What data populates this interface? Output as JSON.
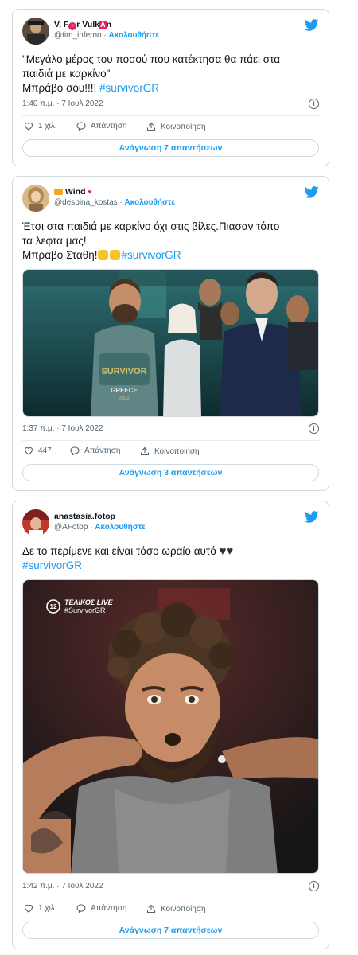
{
  "tweets": [
    {
      "name_parts": [
        "V. F",
        "○",
        "r Vulk",
        "A",
        "n"
      ],
      "handle": "@tim_inferno",
      "follow": "Ακολουθήστε",
      "text_line1": "\"Μεγάλο μέρος του ποσού που κατέκτησα θα πάει στα",
      "text_line2": "παιδιά με καρκίνο\"",
      "text_line3": "Μπράβο σου!!!! ",
      "hashtag": "#survivorGR",
      "timestamp": "1:40 π.μ. · 7 Ιουλ 2022",
      "likes": "1 χιλ.",
      "reply_label": "Απάντηση",
      "share_label": "Κοινοποίηση",
      "replies_button": "Ανάγνωση 7 απαντήσεων"
    },
    {
      "name": "Wind",
      "handle": "@despina_kostas",
      "follow": "Ακολουθήστε",
      "text_line1": "Έτσι στα παιδιά με καρκίνο όχι στις βίλες.Πιασαν τόπο",
      "text_line2": "τα λεφτα μας!",
      "text_line3": "Μπραβο Σταθη!",
      "hashtag": "#survivorGR",
      "image_text_1": "SURVIVOR",
      "image_text_2": "GREECE",
      "image_text_3": "2022",
      "timestamp": "1:37 π.μ. · 7 Ιουλ 2022",
      "likes": "447",
      "reply_label": "Απάντηση",
      "share_label": "Κοινοποίηση",
      "replies_button": "Ανάγνωση 3 απαντήσεων"
    },
    {
      "name": "anastasia.fotop",
      "handle": "@AFotop",
      "follow": "Ακολουθήστε",
      "text_line1": "Δε το περίμενε και είναι τόσο ωραίο αυτό ",
      "hashtag": "#survivorGR",
      "overlay_channel": "12",
      "overlay_title": "ΤΕΛΙΚΟΣ LIVE",
      "overlay_tag": "#SurvivorGR",
      "timestamp": "1:42 π.μ. · 7 Ιουλ 2022",
      "likes": "1 χιλ.",
      "reply_label": "Απάντηση",
      "share_label": "Κοινοποίηση",
      "replies_button": "Ανάγνωση 7 απαντήσεων"
    }
  ],
  "colors": {
    "accent": "#1d9bf0",
    "text": "#0f1419",
    "muted": "#536471",
    "border": "#cfd9de",
    "heart_emoji": "#2f3336",
    "clap_emoji": "#f5c32c"
  },
  "icons": [
    "twitter-bird-icon",
    "heart-icon",
    "reply-bubble-icon",
    "share-icon",
    "info-icon"
  ]
}
